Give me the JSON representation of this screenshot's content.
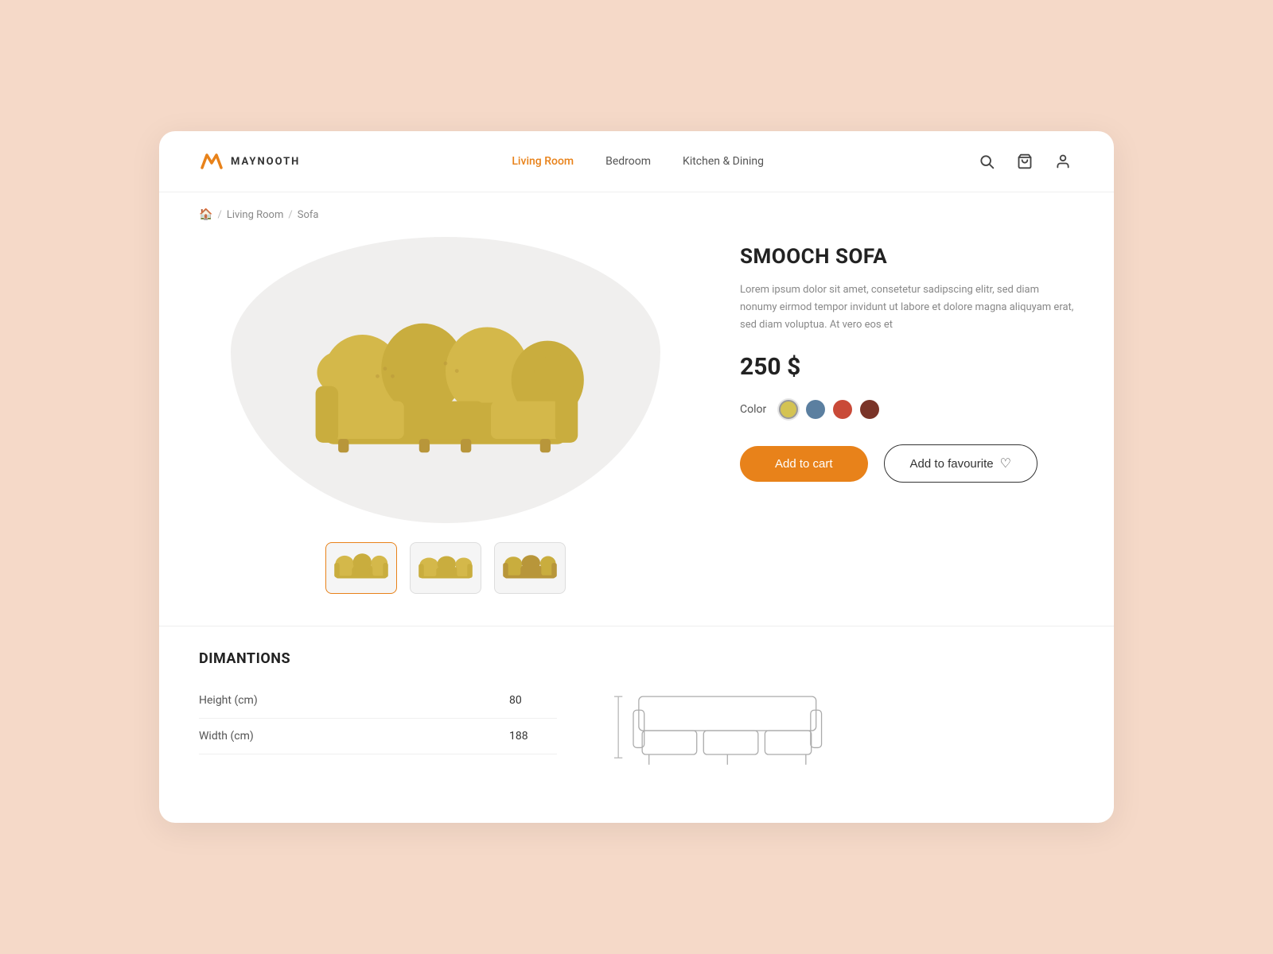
{
  "brand": {
    "name": "MAYNOOTH",
    "logo_letter": "M"
  },
  "nav": {
    "items": [
      {
        "label": "Living Room",
        "active": true
      },
      {
        "label": "Bedroom",
        "active": false
      },
      {
        "label": "Kitchen & Dining",
        "active": false
      }
    ]
  },
  "header_icons": {
    "search": "🔍",
    "cart": "🛒",
    "user": "👤"
  },
  "breadcrumb": {
    "home_icon": "🏠",
    "segments": [
      "Living Room",
      "Sofa"
    ]
  },
  "product": {
    "title": "SMOOCH SOFA",
    "description": "Lorem ipsum dolor sit amet, consetetur sadipscing elitr, sed diam nonumy eirmod tempor invidunt ut labore et dolore magna aliquyam erat, sed diam voluptua. At vero eos et",
    "price": "250 $",
    "color_label": "Color",
    "colors": [
      {
        "hex": "#d4c352",
        "name": "yellow",
        "selected": true
      },
      {
        "hex": "#5b7fa0",
        "name": "blue",
        "selected": false
      },
      {
        "hex": "#c94a38",
        "name": "red",
        "selected": false
      },
      {
        "hex": "#7a3428",
        "name": "brown",
        "selected": false
      }
    ],
    "add_to_cart_label": "Add to cart",
    "add_favourite_label": "Add to favourite"
  },
  "dimensions": {
    "title": "DIMANTIONS",
    "rows": [
      {
        "label": "Height (cm)",
        "value": "80"
      },
      {
        "label": "Width (cm)",
        "value": "188"
      }
    ]
  }
}
